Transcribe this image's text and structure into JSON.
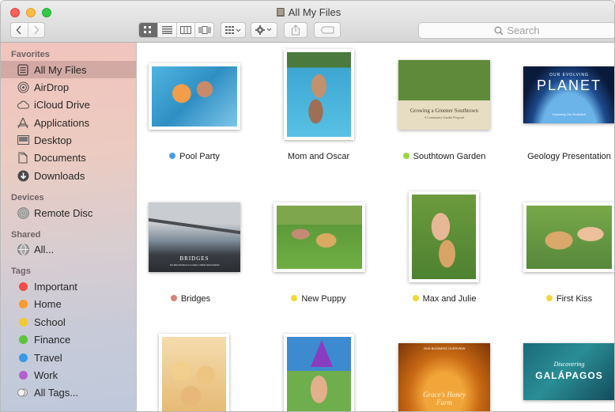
{
  "window": {
    "title": "All My Files"
  },
  "toolbar": {
    "back_icon": "chevron-left-icon",
    "forward_icon": "chevron-right-icon",
    "view_modes": [
      "icon-view-icon",
      "list-view-icon",
      "column-view-icon",
      "cover-flow-icon"
    ],
    "arrange_icon": "arrange-icon",
    "action_icon": "gear-icon",
    "share_icon": "share-icon",
    "tag_icon": "tag-icon",
    "search_placeholder": "Search"
  },
  "sidebar": {
    "favorites_header": "Favorites",
    "favorites": [
      {
        "label": "All My Files",
        "icon": "all-files-icon",
        "selected": true
      },
      {
        "label": "AirDrop",
        "icon": "airdrop-icon"
      },
      {
        "label": "iCloud Drive",
        "icon": "cloud-icon"
      },
      {
        "label": "Applications",
        "icon": "applications-icon"
      },
      {
        "label": "Desktop",
        "icon": "desktop-icon"
      },
      {
        "label": "Documents",
        "icon": "documents-icon"
      },
      {
        "label": "Downloads",
        "icon": "downloads-icon"
      }
    ],
    "devices_header": "Devices",
    "devices": [
      {
        "label": "Remote Disc",
        "icon": "disc-icon"
      }
    ],
    "shared_header": "Shared",
    "shared": [
      {
        "label": "All...",
        "icon": "network-globe-icon"
      }
    ],
    "tags_header": "Tags",
    "tags": [
      {
        "label": "Important",
        "color": "#f24b45"
      },
      {
        "label": "Home",
        "color": "#fb9a2c"
      },
      {
        "label": "School",
        "color": "#f4c831"
      },
      {
        "label": "Finance",
        "color": "#5cc43a"
      },
      {
        "label": "Travel",
        "color": "#3a98e8"
      },
      {
        "label": "Work",
        "color": "#b45fce"
      },
      {
        "label": "All Tags...",
        "color": ""
      }
    ]
  },
  "files": [
    {
      "name": "Pool Party",
      "tag_color": "#4b9be0"
    },
    {
      "name": "Mom and Oscar",
      "tag_color": ""
    },
    {
      "name": "Southtown Garden",
      "tag_color": "#9bd444"
    },
    {
      "name": "Geology Presentation",
      "tag_color": ""
    },
    {
      "name": "Bridges",
      "tag_color": "#e0807c"
    },
    {
      "name": "New Puppy",
      "tag_color": "#f0d838"
    },
    {
      "name": "Max and Julie",
      "tag_color": "#f0d838"
    },
    {
      "name": "First Kiss",
      "tag_color": "#f0d838"
    },
    {
      "name": "",
      "tag_color": ""
    },
    {
      "name": "",
      "tag_color": ""
    },
    {
      "name": "",
      "tag_color": ""
    },
    {
      "name": "",
      "tag_color": ""
    }
  ],
  "covers": {
    "garden_title": "Growing a Greener Southtown",
    "garden_sub": "A Community Garden Proposal",
    "planet_top": "OUR EVOLVING",
    "planet_main": "PLANET",
    "planet_sub": "Exploring Our Evolution",
    "bridges_title": "BRIDGES",
    "bridges_sub": "An introduction to today's oldest innovations",
    "honey_top": "2015 BUSINESS OVERVIEW",
    "honey_title": "Grace's Honey Farm",
    "galapagos_top": "Discovering",
    "galapagos_title": "GALÁPAGOS"
  }
}
